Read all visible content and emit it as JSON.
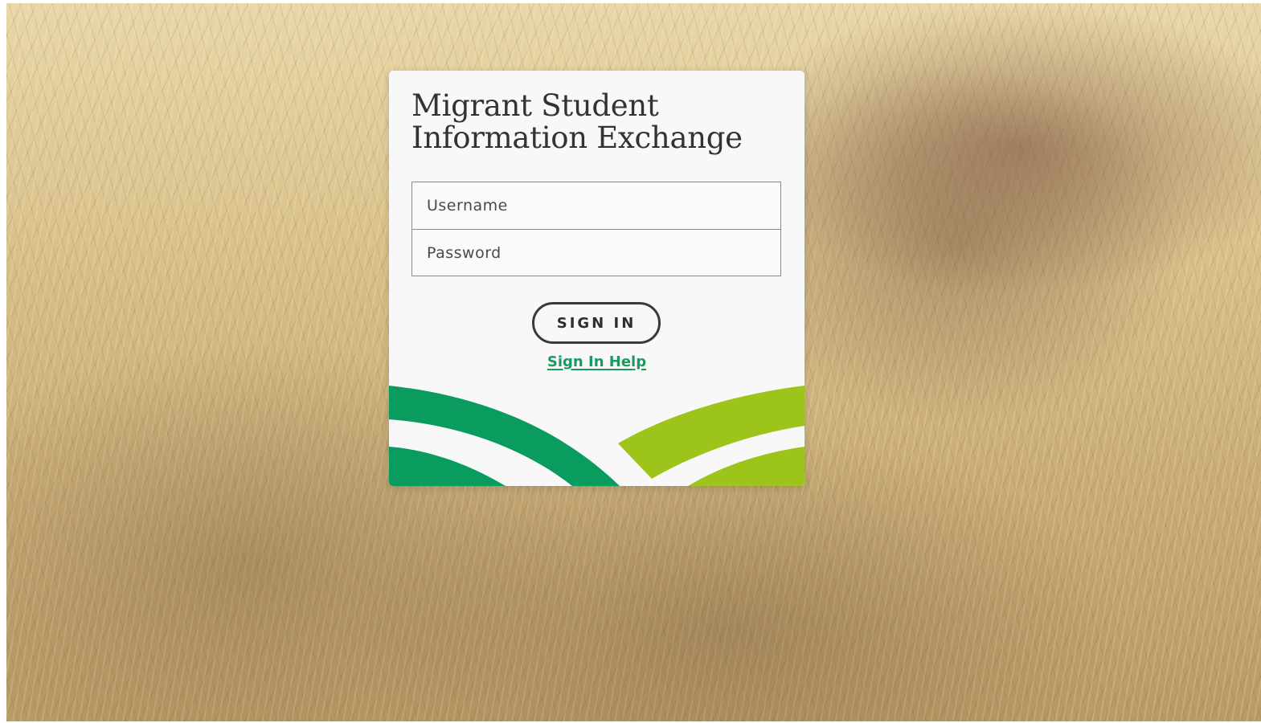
{
  "app": {
    "title_line1": "Migrant Student",
    "title_line2": "Information Exchange"
  },
  "login": {
    "username_placeholder": "Username",
    "username_value": "",
    "password_placeholder": "Password",
    "password_value": "",
    "signin_label": "SIGN IN",
    "help_label": "Sign In Help"
  },
  "colors": {
    "brand_green": "#0a9b5f",
    "brand_lime": "#9dc41a",
    "link_green": "#1a9a5e",
    "card_background": "#f8f8f8"
  }
}
